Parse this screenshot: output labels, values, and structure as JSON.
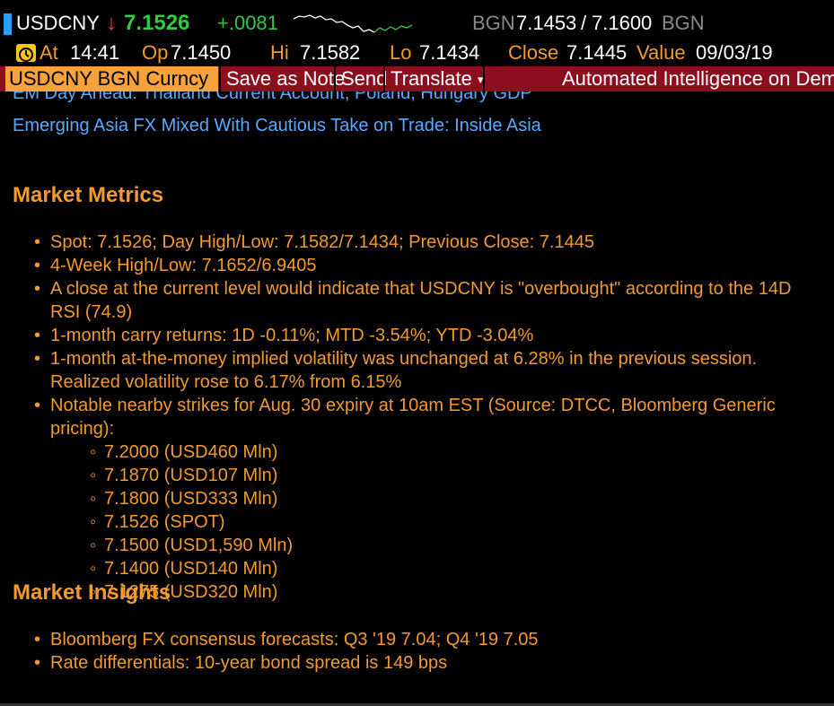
{
  "ticker": {
    "symbol": "USDCNY",
    "direction_arrow": "↓",
    "last": "7.1526",
    "change": "+.0081",
    "source1": "BGN",
    "bid": "7.1453",
    "separator": "/",
    "ask": "7.1600",
    "source2": "BGN"
  },
  "quote_line": {
    "at_label": "At",
    "at_value": "14:41",
    "open_label": "Op",
    "open_value": "7.1450",
    "high_label": "Hi",
    "high_value": "7.1582",
    "low_label": "Lo",
    "low_value": "7.1434",
    "close_label": "Close",
    "close_value": "7.1445",
    "value_label": "Value",
    "value_value": "09/03/19"
  },
  "toolbar": {
    "security": "USDCNY BGN Curncy",
    "save_as_note": "Save as Note",
    "send": "Send",
    "translate": "Translate",
    "translate_arrow": "▾",
    "ai_label": "Automated Intelligence on Demand"
  },
  "news": {
    "partial_headline": "EM Day Ahead: Thailand Current Account; Poland, Hungary GDP",
    "headline": "Emerging Asia FX Mixed With Cautious Take on Trade: Inside Asia"
  },
  "market_metrics": {
    "heading": "Market Metrics",
    "items": [
      "Spot: 7.1526; Day High/Low: 7.1582/7.1434; Previous Close: 7.1445",
      "4-Week High/Low: 7.1652/6.9405",
      "A close at the current level would indicate that USDCNY is \"overbought\" according to the 14D RSI (74.9)",
      "1-month carry returns: 1D -0.11%; MTD -3.54%; YTD -3.04%",
      "1-month at-the-money implied volatility was unchanged at 6.28% in the previous session. Realized volatility rose to 6.17% from 6.15%",
      "Notable nearby strikes for Aug. 30 expiry at 10am EST (Source: DTCC, Bloomberg Generic pricing):"
    ],
    "strikes": [
      "7.2000 (USD460 Mln)",
      "7.1870 (USD107 Mln)",
      "7.1800 (USD333 Mln)",
      "7.1526 (SPOT)",
      "7.1500 (USD1,590 Mln)",
      "7.1400 (USD140 Mln)",
      "7.1275 (USD320 Mln)"
    ]
  },
  "market_insights": {
    "heading": "Market Insights",
    "items": [
      "Bloomberg FX consensus forecasts: Q3 '19 7.04; Q4 '19 7.05",
      "Rate differentials: 10-year bond spread is 149 bps"
    ]
  },
  "colors": {
    "background": "#000000",
    "accent_orange": "#f39a2e",
    "link_blue": "#5aa9ff",
    "up_green": "#2ecc40",
    "down_red": "#ff3b30",
    "toolbar_red": "#8b0f1e"
  }
}
